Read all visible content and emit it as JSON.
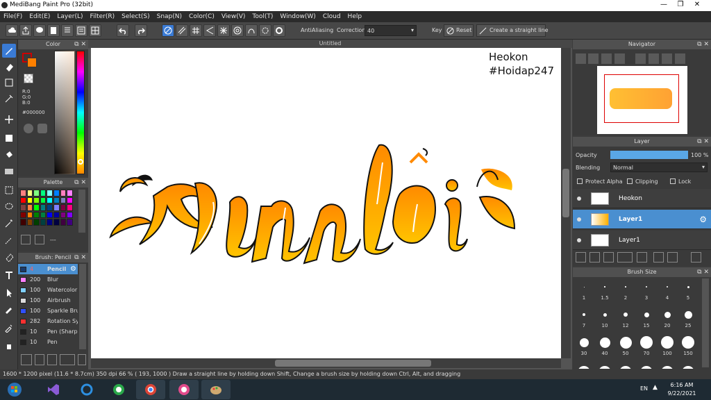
{
  "window": {
    "title": "MediBang Paint Pro (32bit)"
  },
  "menu": [
    "File(F)",
    "Edit(E)",
    "Layer(L)",
    "Filter(R)",
    "Select(S)",
    "Snap(N)",
    "Color(C)",
    "View(V)",
    "Tool(T)",
    "Window(W)",
    "Cloud",
    "Help"
  ],
  "toolbar": {
    "antialiasing_label": "AntiAliasing",
    "correction_label": "Correction",
    "correction_value": "40",
    "key_label": "Key",
    "reset_label": "Reset",
    "straight_line_label": "Create a straight line"
  },
  "color_panel": {
    "title": "Color",
    "r": "R:0",
    "g": "G:0",
    "b": "B:0",
    "hex": "#000000",
    "fg_color": "#000000",
    "bg_color": "#ff8000"
  },
  "palette_panel": {
    "title": "Palette",
    "colors": [
      "#ff8080",
      "#ffff80",
      "#80ff80",
      "#00ff80",
      "#80ffff",
      "#0080ff",
      "#ff80c0",
      "#ff80ff",
      "#ff0000",
      "#ffff00",
      "#80ff00",
      "#00ff40",
      "#00ffff",
      "#0080c0",
      "#8080c0",
      "#ff00ff",
      "#804040",
      "#ff8040",
      "#00ff00",
      "#008080",
      "#004080",
      "#8080ff",
      "#800040",
      "#ff0080",
      "#800000",
      "#ff8000",
      "#008000",
      "#008040",
      "#0000ff",
      "#0000a0",
      "#800080",
      "#8000ff",
      "#400000",
      "#804000",
      "#004000",
      "#004040",
      "#000080",
      "#000040",
      "#400040",
      "#400080"
    ],
    "name_value": "---"
  },
  "brush_panel": {
    "title": "Brush: Pencil",
    "brushes": [
      {
        "size": "4",
        "name": "Pencil",
        "color": "#1a3a6a"
      },
      {
        "size": "200",
        "name": "Blur",
        "color": "#ff80ff"
      },
      {
        "size": "100",
        "name": "Watercolor",
        "color": "#80d0ff"
      },
      {
        "size": "100",
        "name": "Airbrush",
        "color": "#dddddd"
      },
      {
        "size": "100",
        "name": "Sparkle Brush",
        "color": "#3050ff"
      },
      {
        "size": "282",
        "name": "Rotation Sym",
        "color": "#ff3030"
      },
      {
        "size": "10",
        "name": "Pen (Sharp)",
        "color": "#222222"
      },
      {
        "size": "10",
        "name": "Pen",
        "color": "#222222"
      }
    ]
  },
  "canvas": {
    "title": "Untitled",
    "text_line1": "Heokon",
    "text_line2": "#Hoidap247",
    "art_text": "Xin lỗi"
  },
  "navigator": {
    "title": "Navigator"
  },
  "layer_panel": {
    "title": "Layer",
    "opacity_label": "Opacity",
    "opacity_value": "100 %",
    "opacity_fraction": 1.0,
    "blending_label": "Blending",
    "blending_value": "Normal",
    "protect_alpha": "Protect Alpha",
    "clipping": "Clipping",
    "lock": "Lock",
    "layers": [
      {
        "name": "Heokon"
      },
      {
        "name": "Layer1"
      },
      {
        "name": "Layer1"
      }
    ]
  },
  "brush_size_panel": {
    "title": "Brush Size",
    "sizes": [
      "1",
      "1.5",
      "2",
      "3",
      "4",
      "5",
      "7",
      "10",
      "12",
      "15",
      "20",
      "25",
      "30",
      "40",
      "50",
      "70",
      "100",
      "150"
    ]
  },
  "status": {
    "size": "1600 * 1200 pixel",
    "cm": "(11.6 * 8.7cm)",
    "dpi": "350 dpi",
    "zoom": "66 %",
    "coords": "( 193, 1000 )",
    "hint": "Draw a straight line by holding down Shift, Change a brush size by holding down Ctrl, Alt, and dragging"
  },
  "taskbar": {
    "lang": "EN",
    "time": "6:16 AM",
    "date": "9/22/2021"
  }
}
